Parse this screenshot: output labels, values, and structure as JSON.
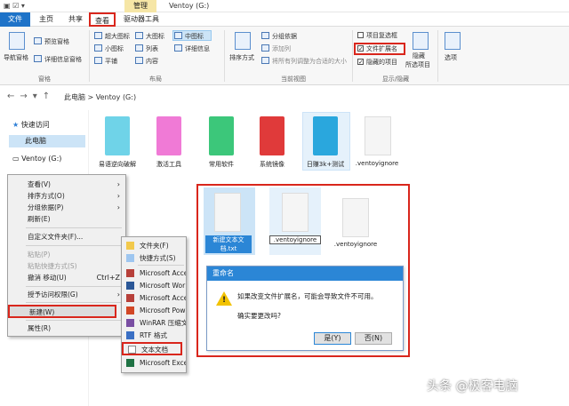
{
  "titlebar": {
    "manage_tab": "管理",
    "window_title": "Ventoy (G:)"
  },
  "tabs": {
    "file": "文件",
    "home": "主页",
    "share": "共享",
    "view": "查看",
    "drive_tools": "驱动器工具"
  },
  "ribbon": {
    "nav_pane": "导航窗格",
    "preview_pane": "预览窗格",
    "details_pane": "详细信息窗格",
    "group_panes": "窗格",
    "layout": {
      "xlarge": "超大图标",
      "large": "大图标",
      "medium": "中图标",
      "small": "小图标",
      "list": "列表",
      "details": "详细信息",
      "tiles": "平铺",
      "content": "内容"
    },
    "group_layout": "布局",
    "sort_by": "排序方式",
    "group_by": "分组依据",
    "add_columns": "添加列",
    "fit_columns": "将所有列调整为合适的大小",
    "group_current_view": "当前视图",
    "item_checkboxes": "项目复选框",
    "file_extensions": "文件扩展名",
    "hidden_items": "隐藏的项目",
    "hide_selected": "隐藏",
    "hide_selected_2": "所选项目",
    "group_show_hide": "显示/隐藏",
    "options": "选项"
  },
  "address": {
    "crumb": "此电脑  >  Ventoy (G:)"
  },
  "sidebar": {
    "quick_access": "快速访问",
    "this_pc": "此电脑",
    "ventoy": "Ventoy (G:)"
  },
  "files": [
    {
      "label": "易语逆向破解",
      "color": "#6fd3e8"
    },
    {
      "label": "激活工具",
      "color": "#f07ad6"
    },
    {
      "label": "常用软件",
      "color": "#3cc77a"
    },
    {
      "label": "系统镜像",
      "color": "#e03a3a"
    },
    {
      "label": "日赚3k+测试",
      "color": "#2aa7dd"
    },
    {
      "label": ".ventoyignore"
    }
  ],
  "context_menu": {
    "view": "查看(V)",
    "sort": "排序方式(O)",
    "group": "分组依据(P)",
    "refresh": "刷新(E)",
    "customize": "自定义文件夹(F)...",
    "paste": "粘贴(P)",
    "paste_shortcut": "粘贴快捷方式(S)",
    "undo": "撤消 移动(U)",
    "undo_key": "Ctrl+Z",
    "grant_access": "授予访问权限(G)",
    "new": "新建(W)",
    "properties": "属性(R)"
  },
  "submenu": {
    "folder": "文件夹(F)",
    "shortcut": "快捷方式(S)",
    "access1": "Microsoft Acce",
    "word": "Microsoft Wor",
    "access2": "Microsoft Acce",
    "ppt": "Microsoft Pow",
    "winrar": "WinRAR 压缩文",
    "rtf": "RTF 格式",
    "txt": "文本文档",
    "excel": "Microsoft Exce"
  },
  "panel": {
    "file1": "新建文本文档.txt",
    "file2": ".ventoyignore",
    "file3": ".ventoyignore"
  },
  "dialog": {
    "title": "重命名",
    "message": "如果改变文件扩展名，可能会导致文件不可用。",
    "question": "确实要更改吗?",
    "yes": "是(Y)",
    "no": "否(N)"
  },
  "watermark": "头条 @极客电脑"
}
